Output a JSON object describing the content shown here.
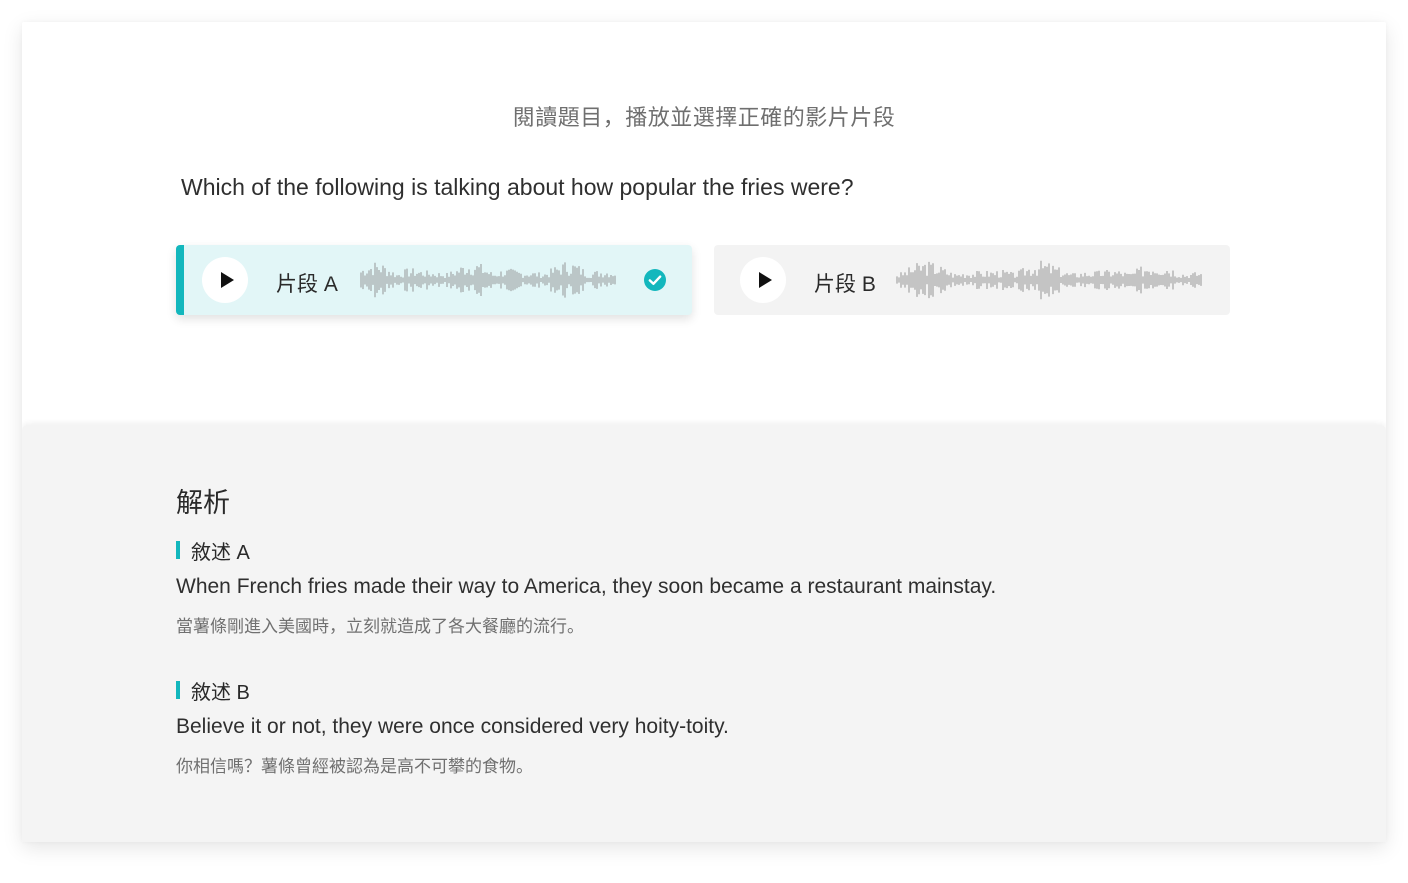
{
  "instruction": "閱讀題目，播放並選擇正確的影片片段",
  "question": "Which of the following is talking about how popular the fries were?",
  "clips": [
    {
      "label": "片段 A",
      "selected": true,
      "play_icon": "play-icon",
      "check_icon": "check-circle-icon"
    },
    {
      "label": "片段 B",
      "selected": false,
      "play_icon": "play-icon"
    }
  ],
  "colors": {
    "accent": "#13b7bd",
    "selected_bg": "#e2f6f7",
    "clip_bg": "#f3f3f3",
    "analysis_bg": "#f4f4f4"
  },
  "analysis": {
    "title": "解析",
    "statements": [
      {
        "label": "敘述 A",
        "english": "When French fries made their way to America, they soon became a restaurant mainstay.",
        "chinese": "當薯條剛進入美國時，立刻就造成了各大餐廳的流行。"
      },
      {
        "label": "敘述 B",
        "english": "Believe it or not, they were once considered very hoity-toity.",
        "chinese": "你相信嗎？薯條曾經被認為是高不可攀的食物。"
      }
    ]
  }
}
